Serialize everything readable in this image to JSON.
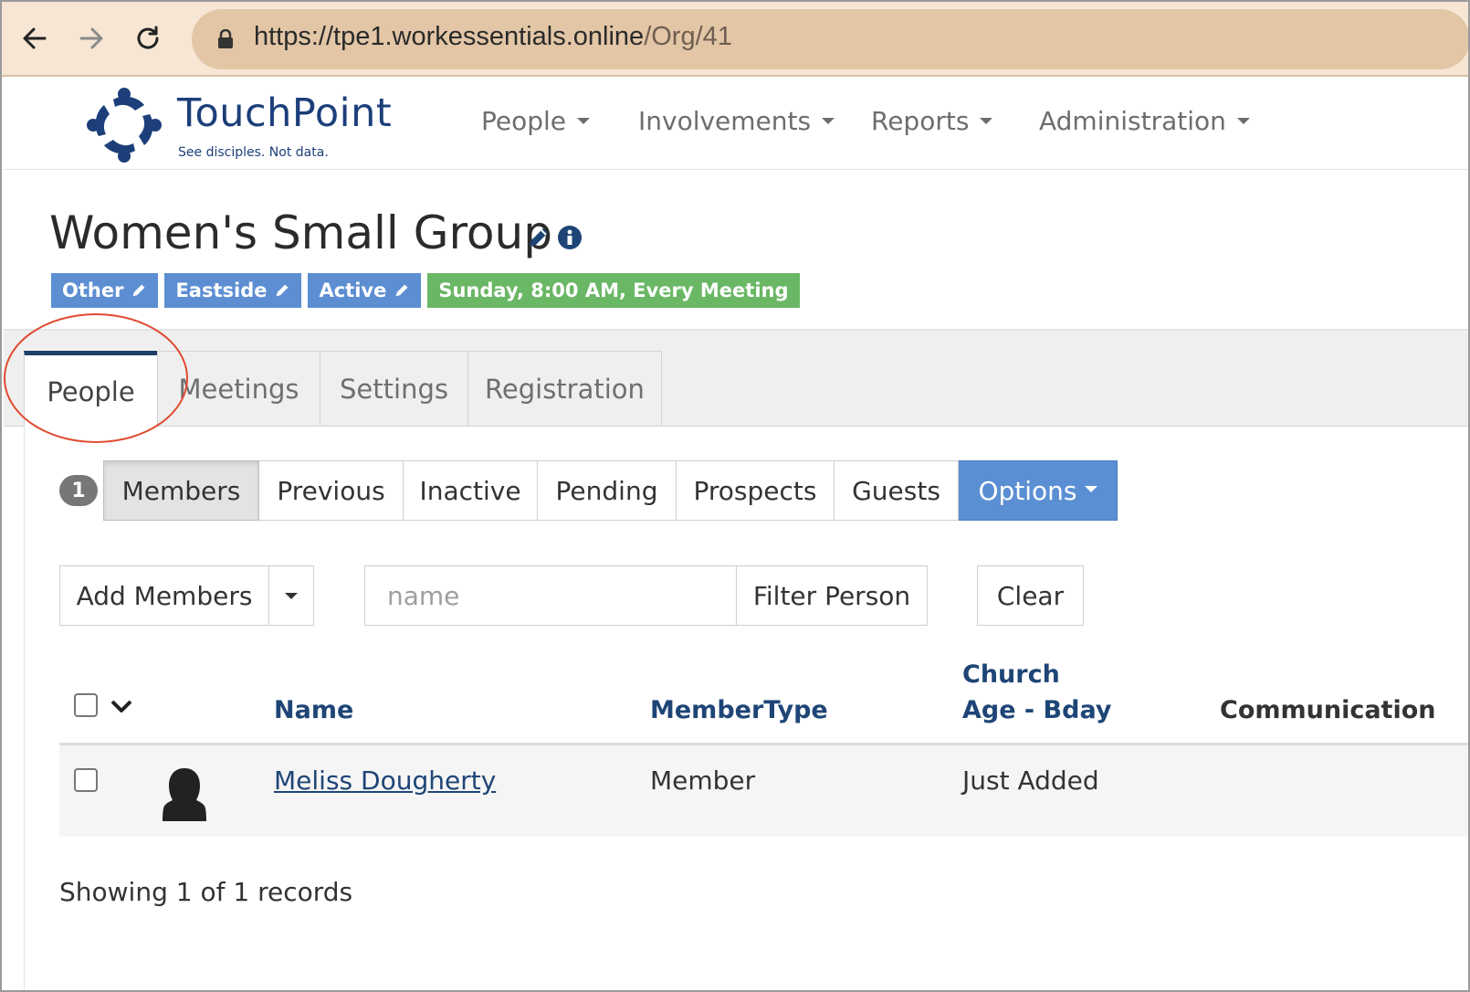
{
  "browser": {
    "url_domain": "https://tpe1.workessentials.online",
    "url_path": "/Org/41"
  },
  "brand": {
    "name": "TouchPoint",
    "tagline": "See disciples. Not data."
  },
  "nav": [
    {
      "label": "People"
    },
    {
      "label": "Involvements"
    },
    {
      "label": "Reports"
    },
    {
      "label": "Administration"
    }
  ],
  "org": {
    "title": "Women's Small Group",
    "badges": [
      {
        "label": "Other",
        "color": "#5d8ed2"
      },
      {
        "label": "Eastside",
        "color": "#5d8ed2"
      },
      {
        "label": "Active",
        "color": "#5d8ed2"
      },
      {
        "label": "Sunday, 8:00 AM, Every Meeting",
        "color": "#6ab766"
      }
    ]
  },
  "tabs": [
    {
      "label": "People",
      "active": true
    },
    {
      "label": "Meetings"
    },
    {
      "label": "Settings"
    },
    {
      "label": "Registration"
    }
  ],
  "member_count": "1",
  "subtabs": [
    {
      "label": "Members"
    },
    {
      "label": "Previous"
    },
    {
      "label": "Inactive"
    },
    {
      "label": "Pending"
    },
    {
      "label": "Prospects"
    },
    {
      "label": "Guests"
    },
    {
      "label": "Options"
    }
  ],
  "actions": {
    "add_members": "Add Members",
    "filter_placeholder": "name",
    "filter_button": "Filter Person",
    "clear_button": "Clear"
  },
  "table": {
    "headers": {
      "name": "Name",
      "member_type": "MemberType",
      "church": "Church",
      "age_bday": "Age - Bday",
      "communication": "Communication"
    },
    "rows": [
      {
        "name": "Meliss Dougherty",
        "member_type": "Member",
        "age": "Just Added"
      }
    ]
  },
  "footer": "Showing 1 of 1 records",
  "colors": {
    "navy": "#1e4576",
    "accent_blue": "#5b8fd3",
    "highlight_red": "#e04a2f"
  }
}
